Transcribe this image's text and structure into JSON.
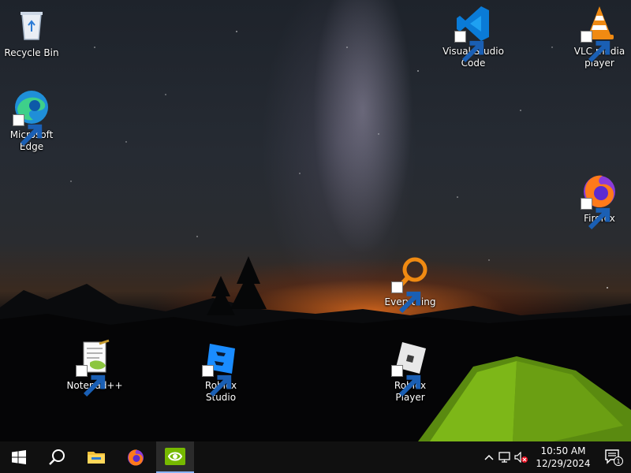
{
  "desktop": {
    "icons": [
      {
        "label": "Recycle Bin"
      },
      {
        "label": "Microsoft Edge"
      },
      {
        "label": "Visual Studio Code"
      },
      {
        "label": "VLC media player"
      },
      {
        "label": "Firefox"
      },
      {
        "label": "Everything"
      },
      {
        "label": "Notepad++"
      },
      {
        "label": "Roblox Studio"
      },
      {
        "label": "Roblox Player"
      }
    ]
  },
  "taskbar": {
    "pinned": [
      "start-icon",
      "search-icon",
      "file-explorer-icon",
      "firefox-icon",
      "nvidia-icon"
    ],
    "active_app": "nvidia-icon",
    "tray": {
      "time": "10:50 AM",
      "date": "12/29/2024",
      "notification_count": "1"
    }
  },
  "colors": {
    "taskbar_bg": "#101010",
    "active_indicator": "#8ab4f8",
    "vscode_blue": "#0a7bd7",
    "nvidia_green": "#76b900"
  }
}
